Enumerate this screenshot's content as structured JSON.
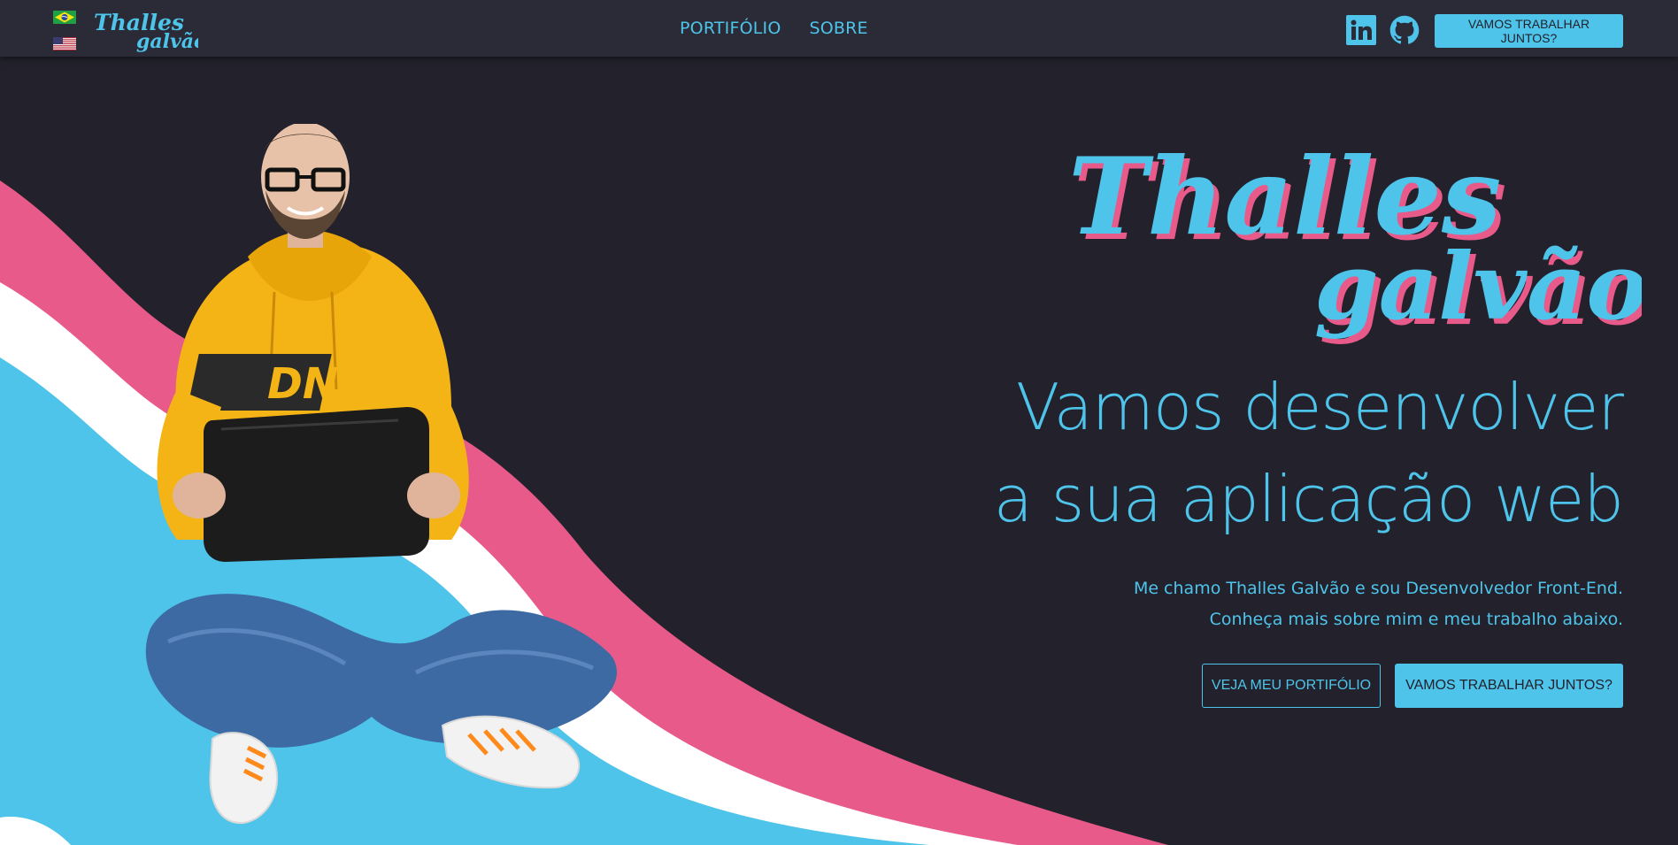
{
  "nav": {
    "logo_text": "Thalles galvão",
    "languages": [
      "Português",
      "English"
    ],
    "links": [
      "PORTIFÓLIO",
      "SOBRE"
    ],
    "social": [
      "linkedin-icon",
      "github-icon"
    ],
    "cta_label": "VAMOS TRABALHAR JUNTOS?"
  },
  "hero": {
    "name_line1": "Thalles",
    "name_line2": "galvão",
    "headline_line1": "Vamos desenvolver",
    "headline_line2": "a sua aplicação web",
    "intro_line1": "Me chamo Thalles Galvão e sou Desenvolvedor Front-End.",
    "intro_line2": "Conheça mais sobre mim e meu trabalho abaixo.",
    "btn_portfolio": "VEJA MEU PORTIFÓLIO",
    "btn_contact": "VAMOS TRABALHAR JUNTOS?"
  },
  "colors": {
    "accent": "#4ec4ea",
    "pink": "#e85a8a",
    "background": "#22212c",
    "navbar": "#2a2b36",
    "hoodie": "#f5b416"
  }
}
